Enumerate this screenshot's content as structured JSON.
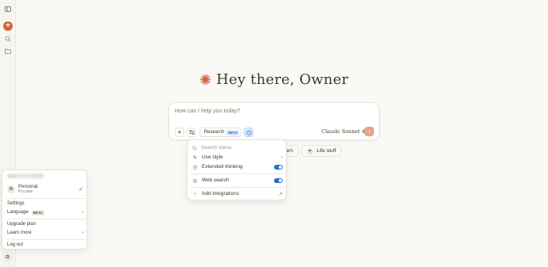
{
  "sidebar": {
    "toggle_icon": "sidebar-toggle-icon",
    "new_chat_glyph": "+",
    "search_icon": "search-icon",
    "projects_icon": "folder-icon"
  },
  "greeting": {
    "icon": "claude-starburst-icon",
    "text": "Hey there, Owner"
  },
  "composer": {
    "placeholder": "How can I help you today?",
    "research_label": "Research",
    "research_badge": "BETA",
    "model_name": "Claude Sonnet 4"
  },
  "chips": [
    {
      "label": "arn",
      "icon": "learn-icon"
    },
    {
      "label": "Life stuff",
      "icon": "coffee-icon"
    }
  ],
  "tools_menu": {
    "search_placeholder": "Search menu",
    "items": [
      {
        "label": "Use style",
        "icon": "pen-icon",
        "right": "chevron",
        "enabled": null
      },
      {
        "label": "Extended thinking",
        "icon": "clock-icon",
        "right": "toggle",
        "enabled": true
      },
      {
        "label": "Web search",
        "icon": "globe-icon",
        "right": "toggle",
        "enabled": true
      },
      {
        "label": "Add integrations",
        "icon": "grid-icon",
        "right": "external",
        "enabled": null
      }
    ]
  },
  "account_menu": {
    "personal_label": "Personal",
    "plan_label": "Pro plan",
    "avatar_letter": "O",
    "settings_label": "Settings",
    "language_label": "Language",
    "language_badge": "BETA",
    "upgrade_label": "Upgrade plan",
    "learn_more_label": "Learn more",
    "logout_label": "Log out"
  },
  "user_avatar_letter": "O",
  "colors": {
    "accent": "#d4633c",
    "toggle_on": "#2b6cd4",
    "background": "#faf9f5"
  }
}
